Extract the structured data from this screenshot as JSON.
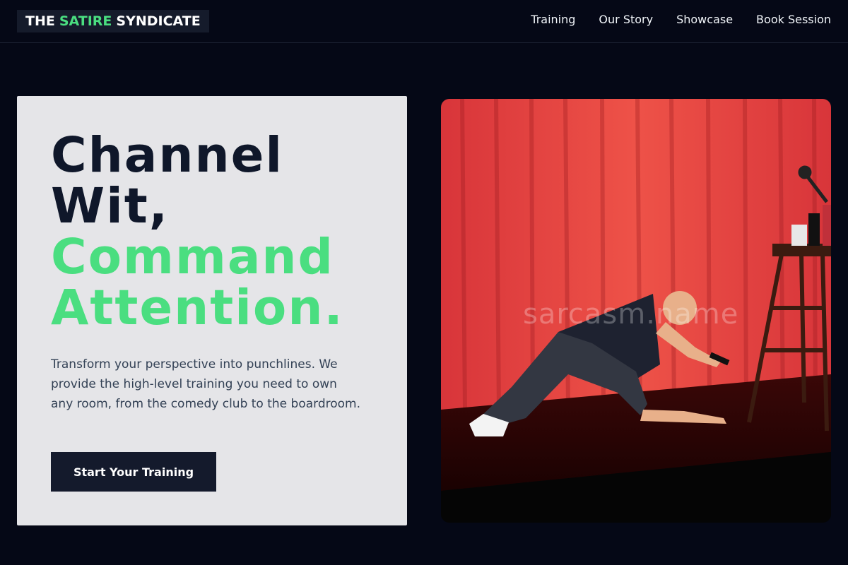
{
  "brand": {
    "prefix": "THE",
    "accent": "SATIRE",
    "suffix": "SYNDICATE"
  },
  "nav": {
    "items": [
      "Training",
      "Our Story",
      "Showcase",
      "Book Session"
    ]
  },
  "hero": {
    "headline_line1": "Channel",
    "headline_line2": "Wit,",
    "headline_line3": "Command",
    "headline_line4": "Attention.",
    "description": "Transform your perspective into punchlines. We provide the high-level training you need to own any room, from the comedy club to the boardroom.",
    "cta_label": "Start Your Training"
  },
  "photo": {
    "watermark": "sarcasm.name"
  },
  "colors": {
    "background": "#050816",
    "accent": "#4ade80",
    "card": "#e5e5e8",
    "dark": "#0f172a",
    "curtain": "#e0403d"
  }
}
